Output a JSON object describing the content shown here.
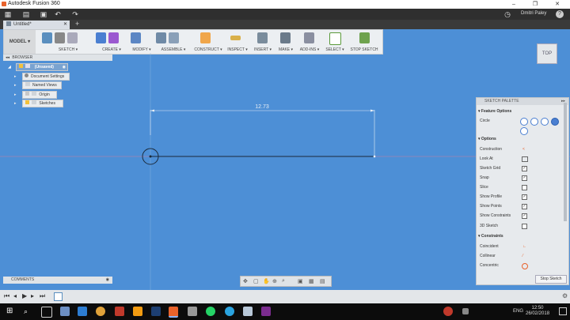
{
  "window": {
    "title": "Autodesk Fusion 360",
    "minimize": "–",
    "maximize": "❐",
    "close": "✕"
  },
  "quickbar": {
    "user_name": "Dmitri Paley",
    "help": "?"
  },
  "tabs": [
    {
      "label": "Untitled*"
    }
  ],
  "toolbar": {
    "workspace": "MODEL",
    "groups": [
      "SKETCH",
      "CREATE",
      "MODIFY",
      "ASSEMBLE",
      "CONSTRUCT",
      "INSPECT",
      "INSERT",
      "MAKE",
      "ADD-INS",
      "SELECT",
      "STOP SKETCH"
    ]
  },
  "browser": {
    "header": "BROWSER",
    "root": "(Unsaved)",
    "items": [
      "Document Settings",
      "Named Views",
      "Origin",
      "Sketches"
    ]
  },
  "canvas": {
    "dimension": "12.73"
  },
  "viewcube": {
    "face": "TOP"
  },
  "palette": {
    "title": "SKETCH PALETTE",
    "feature_options": "Feature Options",
    "circle_label": "Circle",
    "options_header": "Options",
    "options": [
      {
        "label": "Construction",
        "state": "icon"
      },
      {
        "label": "Look At",
        "state": "icon"
      },
      {
        "label": "Sketch Grid",
        "state": "checked"
      },
      {
        "label": "Snap",
        "state": "checked"
      },
      {
        "label": "Slice",
        "state": "unchecked"
      },
      {
        "label": "Show Profile",
        "state": "checked"
      },
      {
        "label": "Show Points",
        "state": "checked"
      },
      {
        "label": "Show Constraints",
        "state": "checked"
      },
      {
        "label": "3D Sketch",
        "state": "unchecked"
      }
    ],
    "constraints_header": "Constraints",
    "constraints": [
      "Coincident",
      "Collinear",
      "Concentric"
    ],
    "stop_button": "Stop Sketch"
  },
  "comments": {
    "label": "COMMENTS"
  },
  "taskbar": {
    "lang": "ENG",
    "time": "12:50",
    "date": "26/02/2018"
  },
  "colors": {
    "canvas": "#4d8fd6",
    "toolbar": "#eceff2",
    "accent": "#e8622b"
  }
}
